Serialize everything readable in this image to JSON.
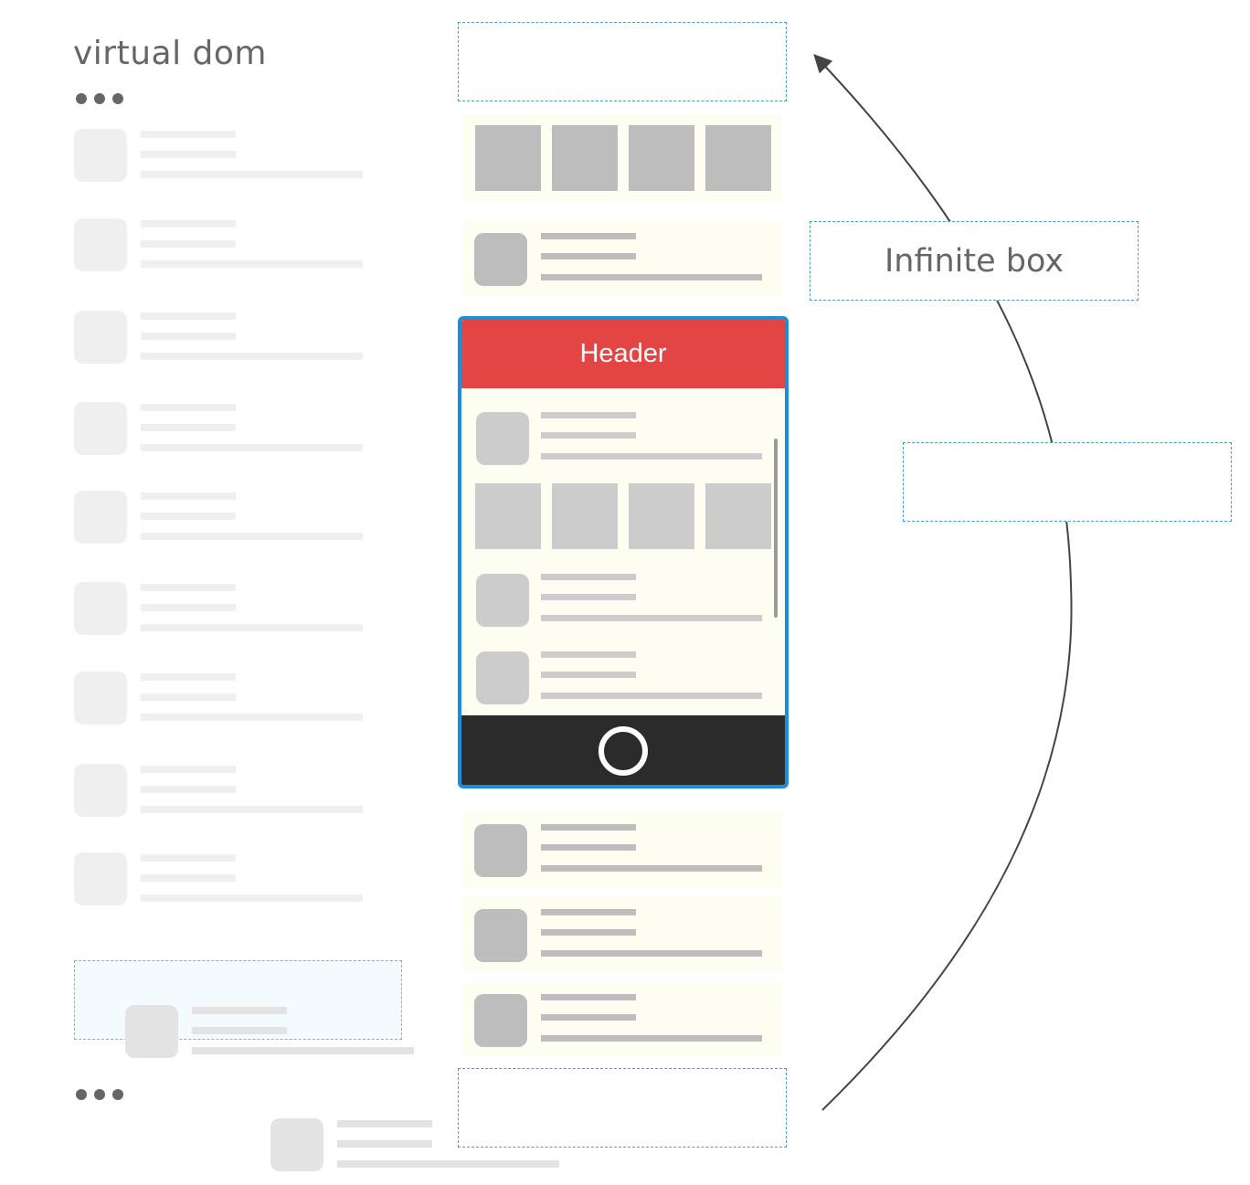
{
  "diagram": {
    "virtual_dom_label": "virtual dom",
    "infinite_box_label": "Infinite box",
    "phone": {
      "header_label": "Header"
    },
    "colors": {
      "header": "#e34444",
      "phone_border": "#1a8fd8",
      "footer": "#2b2b2b",
      "card_background": "#fdfdf1",
      "placeholder": "#bdbdbd",
      "dashed_border": "#4a9bd1"
    },
    "icons": [
      "ellipsis-icon",
      "home-button-icon",
      "curved-arrow"
    ]
  }
}
